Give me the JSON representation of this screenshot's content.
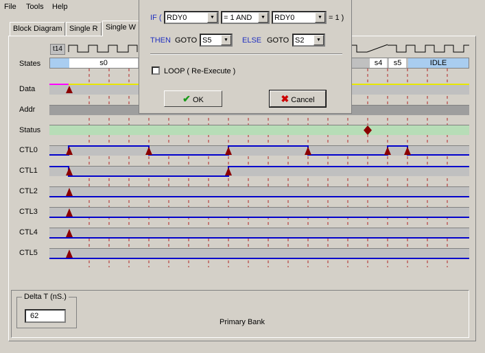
{
  "menu": {
    "file": "File",
    "tools": "Tools",
    "help": "Help"
  },
  "tabs": [
    "Block Diagram",
    "Single R",
    "Single W"
  ],
  "timeline": {
    "start_label": "t14",
    "state_s0": "s0",
    "state_s4": "s4",
    "state_s5": "s5",
    "state_idle": "IDLE"
  },
  "rows": [
    "States",
    "Data",
    "Addr",
    "Status",
    "CTL0",
    "CTL1",
    "CTL2",
    "CTL3",
    "CTL4",
    "CTL5"
  ],
  "bottom": {
    "delta_title": "Delta T (nS.)",
    "delta_value": "62",
    "bank": "Primary Bank"
  },
  "dialog": {
    "if_label": "IF (",
    "cond1": "RDY0",
    "op": "= 1  AND",
    "cond2": "RDY0",
    "eq_tail": "= 1 )",
    "then_label": "THEN",
    "goto1": "GOTO",
    "then_target": "S5",
    "else_label": "ELSE",
    "goto2": "GOTO",
    "else_target": "S2",
    "loop_label": "LOOP  ( Re-Execute )",
    "ok": "OK",
    "cancel": "Cancel"
  },
  "colors": {
    "accent_blue": "#0000cc",
    "marker": "#8b0000",
    "status_green": "#b7ddb7",
    "states_blue": "#a9cdf0"
  }
}
